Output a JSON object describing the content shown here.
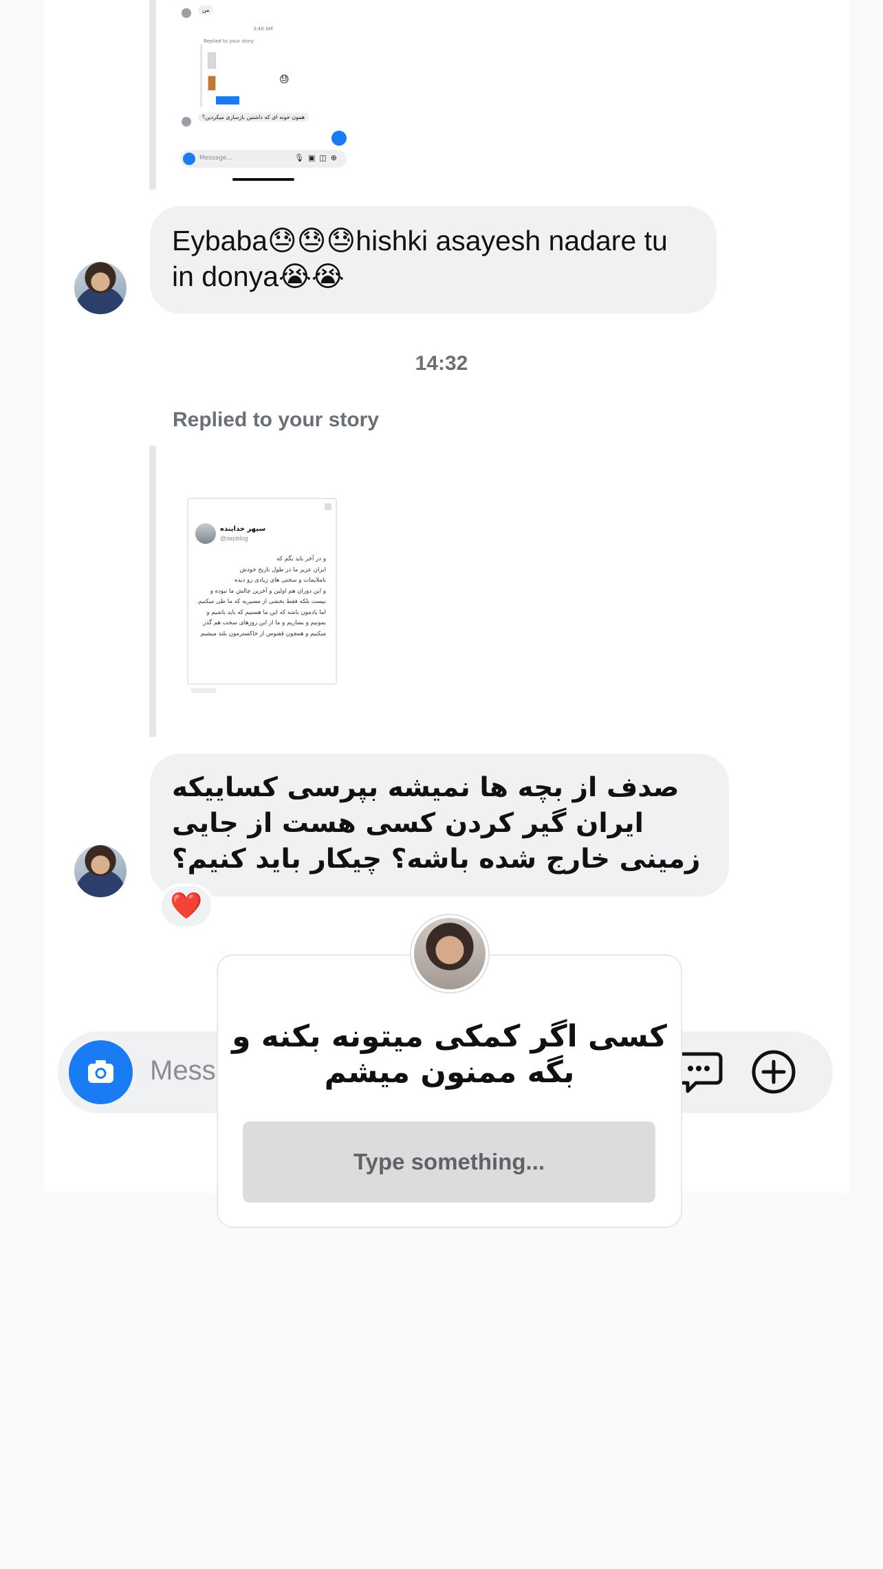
{
  "nested_screenshot": {
    "bubble_top": "من",
    "time": "3:40 AM",
    "replied_label": "Replied to your story",
    "bubble_bottom": "همون خونه ای  که داشتین بازسازی میکردین؟",
    "emoji": "😓",
    "composer_placeholder": "Message..."
  },
  "messages": [
    {
      "text": "Eybaba😓😓😓hishki asayesh nadare tu in donya😭😭"
    },
    {
      "text": "صدف از بچه ها نمیشه بپرسی کساییکه ایران گیر کردن کسی هست از جایی زمینی خارج شده باشه؟ چیکار باید کنیم؟"
    }
  ],
  "timestamp": "14:32",
  "replied_label": "Replied to your story",
  "story": {
    "name": "سپهر خداینده",
    "handle": "@sepblog",
    "lines": [
      "و در آخر باید بگم که",
      "ایران عزیز ما در طول تاریخ خودش",
      "ناملایمات و سختی های زیادی رو دیده",
      "و این دوران هم اولین و آخرین چالش ما نبوده و",
      "نیست بلکه فقط بخشی از مسیریه که ما طی میکنیم.",
      "اما یادمون باشه که این ما هستیم که باید باشیم و",
      "بمونیم و بسازیم و ما از این روزهای سخت هم گذر",
      "میکنیم و همچون ققنوس از خاکسترمون بلند میشیم"
    ]
  },
  "reaction": "❤️",
  "composer": {
    "placeholder": "Mess"
  },
  "popup": {
    "text": "کسی اگر کمکی میتونه بکنه و بگه ممنون میشم",
    "input_placeholder": "Type something..."
  }
}
